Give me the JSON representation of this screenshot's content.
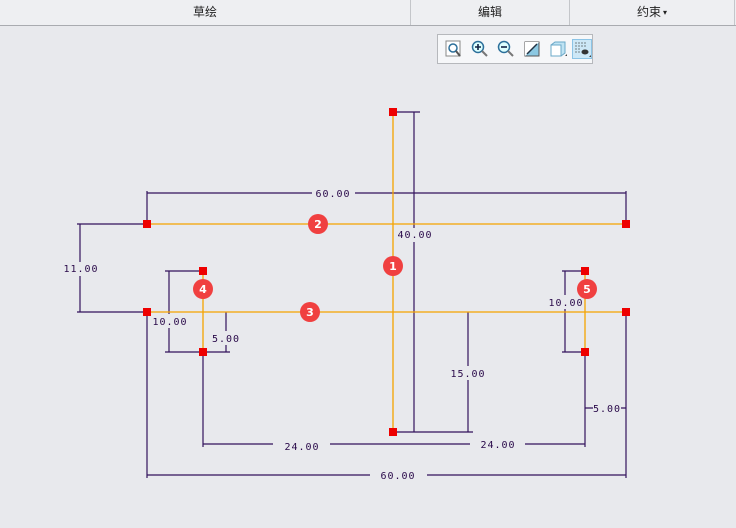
{
  "tabs": [
    {
      "label": "草绘"
    },
    {
      "label": "编辑"
    },
    {
      "label": "约束",
      "caret": "▾"
    }
  ],
  "toolbar": {
    "items": [
      "zoom-fit-icon",
      "zoom-in-icon",
      "zoom-out-icon",
      "display-style-icon",
      "view-3d-icon",
      "sketch-display-filter-icon"
    ],
    "active": "sketch-display-filter-icon"
  },
  "colors": {
    "entity": "#f5a300",
    "dimension": "#33135c",
    "point": "#ee0000",
    "badge": "#f04040"
  },
  "entities": [
    {
      "id": "1"
    },
    {
      "id": "2"
    },
    {
      "id": "3"
    },
    {
      "id": "4"
    },
    {
      "id": "5"
    }
  ],
  "dimensions": {
    "top_width": "60.00",
    "left_gap": "11.00",
    "center_height": "40.00",
    "left_short": "10.00",
    "left_offset": "5.00",
    "center_offset": "15.00",
    "right_short": "10.00",
    "right_offset": "5.00",
    "left_span": "24.00",
    "right_span": "24.00",
    "bottom_width": "60.00"
  }
}
